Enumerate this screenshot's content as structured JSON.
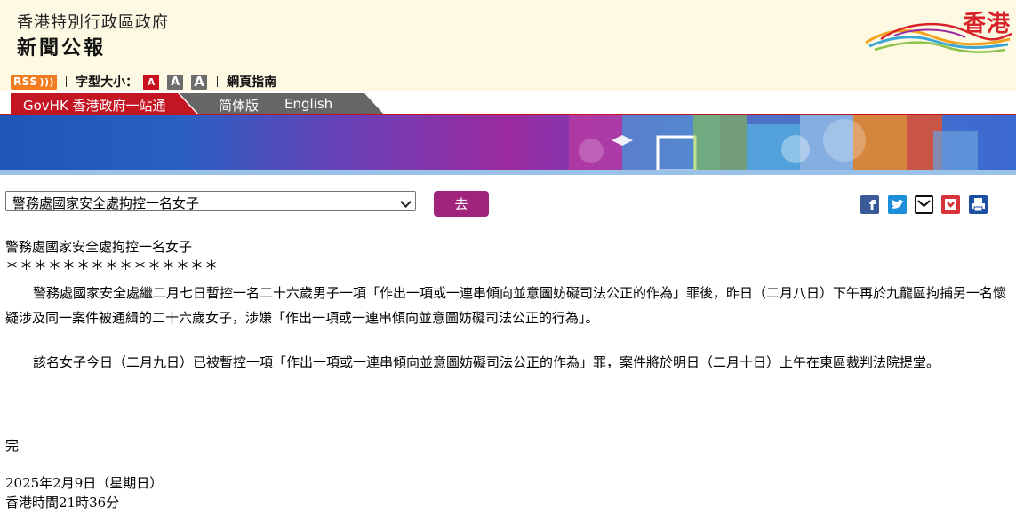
{
  "header": {
    "line1": "香港特別行政區政府",
    "line2": "新聞公報",
    "brand": "香港"
  },
  "toolbar": {
    "rss": "RSS",
    "font_size_label": "字型大小：",
    "font_buttons": [
      "A",
      "A",
      "A"
    ],
    "guide": "網頁指南"
  },
  "tabs": {
    "govhk": "GovHK 香港政府一站通",
    "simplified": "简体版",
    "english": "English"
  },
  "nav": {
    "selected": "警務處國家安全處拘控一名女子",
    "go": "去"
  },
  "share_icons": [
    "facebook-icon",
    "twitter-icon",
    "email-icon",
    "bookmark-icon",
    "print-icon"
  ],
  "colors": {
    "accent": "#a0247c",
    "gov_red": "#c41522",
    "header_bg": "#fdf9e3"
  },
  "article": {
    "headline": "警務處國家安全處拘控一名女子",
    "stars": "＊＊＊＊＊＊＊＊＊＊＊＊＊＊＊",
    "paragraphs": [
      "警務處國家安全處繼二月七日暫控一名二十六歲男子一項「作出一項或一連串傾向並意圖妨礙司法公正的作為」罪後，昨日（二月八日）下午再於九龍區拘捕另一名懷疑涉及同一案件被通緝的二十六歲女子，涉嫌「作出一項或一連串傾向並意圖妨礙司法公正的行為」。",
      "該名女子今日（二月九日）已被暫控一項「作出一項或一連串傾向並意圖妨礙司法公正的作為」罪，案件將於明日（二月十日）上午在東區裁判法院提堂。"
    ],
    "end": "完",
    "date": "2025年2月9日（星期日）",
    "time": "香港時間21時36分"
  }
}
